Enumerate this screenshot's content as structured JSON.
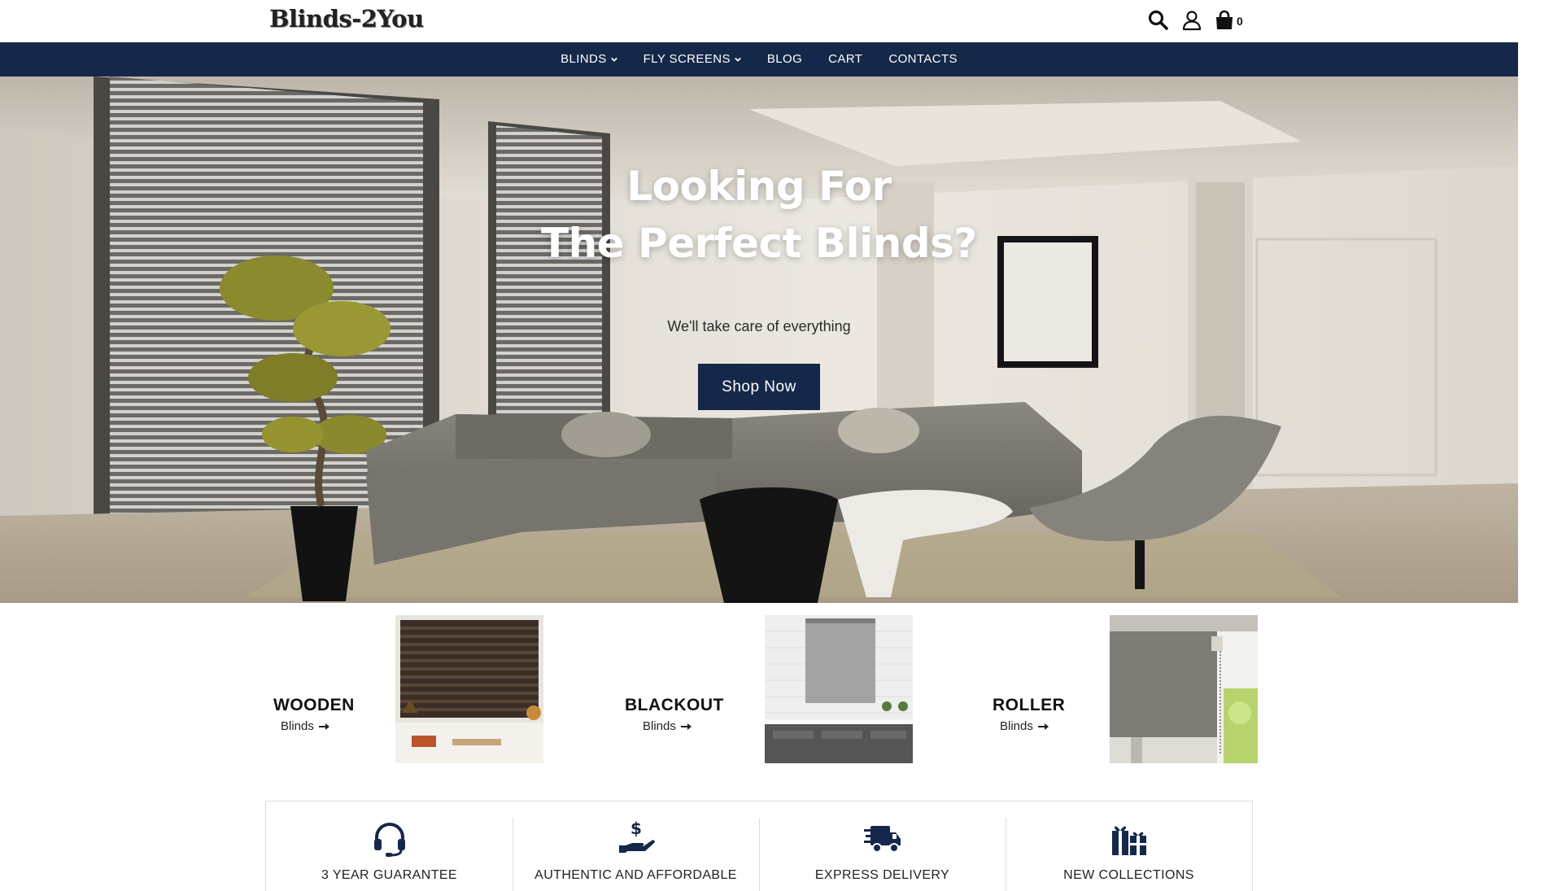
{
  "header": {
    "logo_text": "Blinds-2You",
    "cart_count": "0",
    "icons": [
      "search-icon",
      "user-icon",
      "shopping-bag-icon"
    ]
  },
  "nav": {
    "items": [
      {
        "label": "BLINDS",
        "dropdown": true
      },
      {
        "label": "FLY SCREENS",
        "dropdown": true
      },
      {
        "label": "BLOG",
        "dropdown": false
      },
      {
        "label": "CART",
        "dropdown": false
      },
      {
        "label": "CONTACTS",
        "dropdown": false
      }
    ]
  },
  "hero": {
    "title_line1": "Looking For",
    "title_line2": "The Perfect Blinds?",
    "subtitle": "We'll take care of everything",
    "cta_label": "Shop Now"
  },
  "categories": [
    {
      "title": "WOODEN",
      "link": "Blinds"
    },
    {
      "title": "BLACKOUT",
      "link": "Blinds"
    },
    {
      "title": "ROLLER",
      "link": "Blinds"
    }
  ],
  "features": [
    {
      "label": "3 YEAR GUARANTEE",
      "icon": "headset-icon"
    },
    {
      "label": "AUTHENTIC AND AFFORDABLE",
      "icon": "hand-dollar-icon"
    },
    {
      "label": "EXPRESS DELIVERY",
      "icon": "delivery-truck-icon"
    },
    {
      "label": "NEW COLLECTIONS",
      "icon": "gifts-icon"
    }
  ],
  "colors": {
    "primary_navy": "#15284a",
    "white": "#ffffff",
    "text": "#1a1a1a"
  }
}
